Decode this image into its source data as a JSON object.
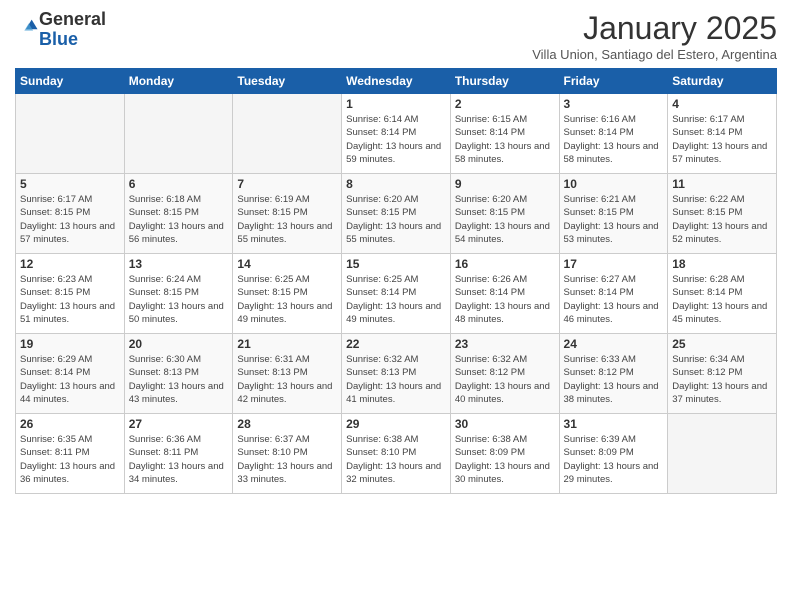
{
  "logo": {
    "general": "General",
    "blue": "Blue"
  },
  "header": {
    "month": "January 2025",
    "location": "Villa Union, Santiago del Estero, Argentina"
  },
  "days_of_week": [
    "Sunday",
    "Monday",
    "Tuesday",
    "Wednesday",
    "Thursday",
    "Friday",
    "Saturday"
  ],
  "weeks": [
    [
      {
        "day": "",
        "sunrise": "",
        "sunset": "",
        "daylight": ""
      },
      {
        "day": "",
        "sunrise": "",
        "sunset": "",
        "daylight": ""
      },
      {
        "day": "",
        "sunrise": "",
        "sunset": "",
        "daylight": ""
      },
      {
        "day": "1",
        "sunrise": "Sunrise: 6:14 AM",
        "sunset": "Sunset: 8:14 PM",
        "daylight": "Daylight: 13 hours and 59 minutes."
      },
      {
        "day": "2",
        "sunrise": "Sunrise: 6:15 AM",
        "sunset": "Sunset: 8:14 PM",
        "daylight": "Daylight: 13 hours and 58 minutes."
      },
      {
        "day": "3",
        "sunrise": "Sunrise: 6:16 AM",
        "sunset": "Sunset: 8:14 PM",
        "daylight": "Daylight: 13 hours and 58 minutes."
      },
      {
        "day": "4",
        "sunrise": "Sunrise: 6:17 AM",
        "sunset": "Sunset: 8:14 PM",
        "daylight": "Daylight: 13 hours and 57 minutes."
      }
    ],
    [
      {
        "day": "5",
        "sunrise": "Sunrise: 6:17 AM",
        "sunset": "Sunset: 8:15 PM",
        "daylight": "Daylight: 13 hours and 57 minutes."
      },
      {
        "day": "6",
        "sunrise": "Sunrise: 6:18 AM",
        "sunset": "Sunset: 8:15 PM",
        "daylight": "Daylight: 13 hours and 56 minutes."
      },
      {
        "day": "7",
        "sunrise": "Sunrise: 6:19 AM",
        "sunset": "Sunset: 8:15 PM",
        "daylight": "Daylight: 13 hours and 55 minutes."
      },
      {
        "day": "8",
        "sunrise": "Sunrise: 6:20 AM",
        "sunset": "Sunset: 8:15 PM",
        "daylight": "Daylight: 13 hours and 55 minutes."
      },
      {
        "day": "9",
        "sunrise": "Sunrise: 6:20 AM",
        "sunset": "Sunset: 8:15 PM",
        "daylight": "Daylight: 13 hours and 54 minutes."
      },
      {
        "day": "10",
        "sunrise": "Sunrise: 6:21 AM",
        "sunset": "Sunset: 8:15 PM",
        "daylight": "Daylight: 13 hours and 53 minutes."
      },
      {
        "day": "11",
        "sunrise": "Sunrise: 6:22 AM",
        "sunset": "Sunset: 8:15 PM",
        "daylight": "Daylight: 13 hours and 52 minutes."
      }
    ],
    [
      {
        "day": "12",
        "sunrise": "Sunrise: 6:23 AM",
        "sunset": "Sunset: 8:15 PM",
        "daylight": "Daylight: 13 hours and 51 minutes."
      },
      {
        "day": "13",
        "sunrise": "Sunrise: 6:24 AM",
        "sunset": "Sunset: 8:15 PM",
        "daylight": "Daylight: 13 hours and 50 minutes."
      },
      {
        "day": "14",
        "sunrise": "Sunrise: 6:25 AM",
        "sunset": "Sunset: 8:15 PM",
        "daylight": "Daylight: 13 hours and 49 minutes."
      },
      {
        "day": "15",
        "sunrise": "Sunrise: 6:25 AM",
        "sunset": "Sunset: 8:14 PM",
        "daylight": "Daylight: 13 hours and 49 minutes."
      },
      {
        "day": "16",
        "sunrise": "Sunrise: 6:26 AM",
        "sunset": "Sunset: 8:14 PM",
        "daylight": "Daylight: 13 hours and 48 minutes."
      },
      {
        "day": "17",
        "sunrise": "Sunrise: 6:27 AM",
        "sunset": "Sunset: 8:14 PM",
        "daylight": "Daylight: 13 hours and 46 minutes."
      },
      {
        "day": "18",
        "sunrise": "Sunrise: 6:28 AM",
        "sunset": "Sunset: 8:14 PM",
        "daylight": "Daylight: 13 hours and 45 minutes."
      }
    ],
    [
      {
        "day": "19",
        "sunrise": "Sunrise: 6:29 AM",
        "sunset": "Sunset: 8:14 PM",
        "daylight": "Daylight: 13 hours and 44 minutes."
      },
      {
        "day": "20",
        "sunrise": "Sunrise: 6:30 AM",
        "sunset": "Sunset: 8:13 PM",
        "daylight": "Daylight: 13 hours and 43 minutes."
      },
      {
        "day": "21",
        "sunrise": "Sunrise: 6:31 AM",
        "sunset": "Sunset: 8:13 PM",
        "daylight": "Daylight: 13 hours and 42 minutes."
      },
      {
        "day": "22",
        "sunrise": "Sunrise: 6:32 AM",
        "sunset": "Sunset: 8:13 PM",
        "daylight": "Daylight: 13 hours and 41 minutes."
      },
      {
        "day": "23",
        "sunrise": "Sunrise: 6:32 AM",
        "sunset": "Sunset: 8:12 PM",
        "daylight": "Daylight: 13 hours and 40 minutes."
      },
      {
        "day": "24",
        "sunrise": "Sunrise: 6:33 AM",
        "sunset": "Sunset: 8:12 PM",
        "daylight": "Daylight: 13 hours and 38 minutes."
      },
      {
        "day": "25",
        "sunrise": "Sunrise: 6:34 AM",
        "sunset": "Sunset: 8:12 PM",
        "daylight": "Daylight: 13 hours and 37 minutes."
      }
    ],
    [
      {
        "day": "26",
        "sunrise": "Sunrise: 6:35 AM",
        "sunset": "Sunset: 8:11 PM",
        "daylight": "Daylight: 13 hours and 36 minutes."
      },
      {
        "day": "27",
        "sunrise": "Sunrise: 6:36 AM",
        "sunset": "Sunset: 8:11 PM",
        "daylight": "Daylight: 13 hours and 34 minutes."
      },
      {
        "day": "28",
        "sunrise": "Sunrise: 6:37 AM",
        "sunset": "Sunset: 8:10 PM",
        "daylight": "Daylight: 13 hours and 33 minutes."
      },
      {
        "day": "29",
        "sunrise": "Sunrise: 6:38 AM",
        "sunset": "Sunset: 8:10 PM",
        "daylight": "Daylight: 13 hours and 32 minutes."
      },
      {
        "day": "30",
        "sunrise": "Sunrise: 6:38 AM",
        "sunset": "Sunset: 8:09 PM",
        "daylight": "Daylight: 13 hours and 30 minutes."
      },
      {
        "day": "31",
        "sunrise": "Sunrise: 6:39 AM",
        "sunset": "Sunset: 8:09 PM",
        "daylight": "Daylight: 13 hours and 29 minutes."
      },
      {
        "day": "",
        "sunrise": "",
        "sunset": "",
        "daylight": ""
      }
    ]
  ]
}
